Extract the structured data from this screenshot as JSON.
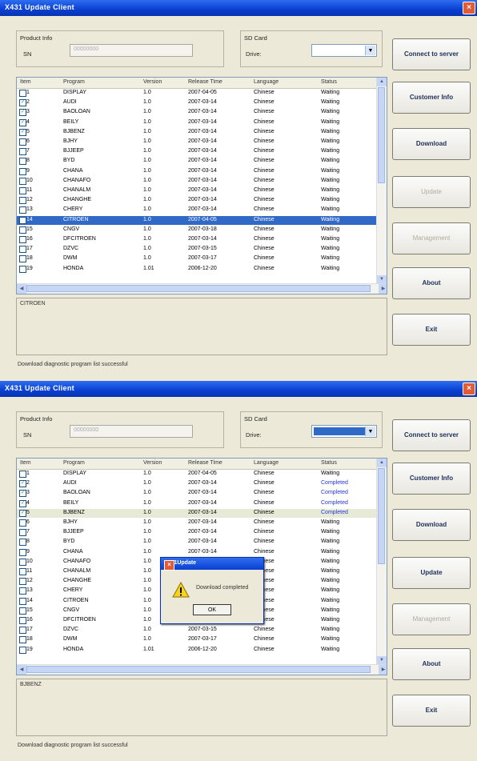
{
  "window1": {
    "title": "X431 Update Client",
    "product_info_label": "Product Info",
    "sn_label": "SN",
    "sn_value": "00000000",
    "sd_card_label": "SD Card",
    "drive_label": "Drive:",
    "columns": [
      "Item",
      "Program",
      "Version",
      "Release Time",
      "Language",
      "Status"
    ],
    "rows": [
      {
        "item": "1",
        "program": "DISPLAY",
        "version": "1.0",
        "release": "2007-04-05",
        "language": "Chinese",
        "status": "Waiting",
        "checked": false
      },
      {
        "item": "2",
        "program": "AUDI",
        "version": "1.0",
        "release": "2007-03-14",
        "language": "Chinese",
        "status": "Waiting",
        "checked": true
      },
      {
        "item": "3",
        "program": "BAOLOAN",
        "version": "1.0",
        "release": "2007-03-14",
        "language": "Chinese",
        "status": "Waiting",
        "checked": true
      },
      {
        "item": "4",
        "program": "BEILY",
        "version": "1.0",
        "release": "2007-03-14",
        "language": "Chinese",
        "status": "Waiting",
        "checked": true
      },
      {
        "item": "5",
        "program": "BJBENZ",
        "version": "1.0",
        "release": "2007-03-14",
        "language": "Chinese",
        "status": "Waiting",
        "checked": true
      },
      {
        "item": "6",
        "program": "BJHY",
        "version": "1.0",
        "release": "2007-03-14",
        "language": "Chinese",
        "status": "Waiting",
        "checked": false
      },
      {
        "item": "7",
        "program": "BJJEEP",
        "version": "1.0",
        "release": "2007-03-14",
        "language": "Chinese",
        "status": "Waiting",
        "checked": false
      },
      {
        "item": "8",
        "program": "BYD",
        "version": "1.0",
        "release": "2007-03-14",
        "language": "Chinese",
        "status": "Waiting",
        "checked": false
      },
      {
        "item": "9",
        "program": "CHANA",
        "version": "1.0",
        "release": "2007-03-14",
        "language": "Chinese",
        "status": "Waiting",
        "checked": false
      },
      {
        "item": "10",
        "program": "CHANAFO",
        "version": "1.0",
        "release": "2007-03-14",
        "language": "Chinese",
        "status": "Waiting",
        "checked": false
      },
      {
        "item": "11",
        "program": "CHANALM",
        "version": "1.0",
        "release": "2007-03-14",
        "language": "Chinese",
        "status": "Waiting",
        "checked": false
      },
      {
        "item": "12",
        "program": "CHANGHE",
        "version": "1.0",
        "release": "2007-03-14",
        "language": "Chinese",
        "status": "Waiting",
        "checked": false
      },
      {
        "item": "13",
        "program": "CHERY",
        "version": "1.0",
        "release": "2007-03-14",
        "language": "Chinese",
        "status": "Waiting",
        "checked": false
      },
      {
        "item": "14",
        "program": "CITROEN",
        "version": "1.0",
        "release": "2007-04-05",
        "language": "Chinese",
        "status": "Waiting",
        "checked": true,
        "highlight": true
      },
      {
        "item": "15",
        "program": "CNGV",
        "version": "1.0",
        "release": "2007-03-18",
        "language": "Chinese",
        "status": "Waiting",
        "checked": false
      },
      {
        "item": "16",
        "program": "DFCITROEN",
        "version": "1.0",
        "release": "2007-03-14",
        "language": "Chinese",
        "status": "Waiting",
        "checked": false
      },
      {
        "item": "17",
        "program": "DZVC",
        "version": "1.0",
        "release": "2007-03-15",
        "language": "Chinese",
        "status": "Waiting",
        "checked": false
      },
      {
        "item": "18",
        "program": "DWM",
        "version": "1.0",
        "release": "2007-03-17",
        "language": "Chinese",
        "status": "Waiting",
        "checked": false
      },
      {
        "item": "19",
        "program": "HONDA",
        "version": "1.01",
        "release": "2006-12-20",
        "language": "Chinese",
        "status": "Waiting",
        "checked": false
      }
    ],
    "info_text": "CITROEN",
    "status_text": "Download diagnostic program list successful",
    "buttons": {
      "connect": "Connect to server",
      "customer": "Customer Info",
      "download": "Download",
      "update": "Update",
      "management": "Management",
      "about": "About",
      "exit": "Exit"
    }
  },
  "window2": {
    "title": "X431 Update Client",
    "product_info_label": "Product Info",
    "sn_label": "SN",
    "sn_value": "00000000",
    "sd_card_label": "SD Card",
    "drive_label": "Drive:",
    "columns": [
      "Item",
      "Program",
      "Version",
      "Release Time",
      "Language",
      "Status"
    ],
    "rows": [
      {
        "item": "1",
        "program": "DISPLAY",
        "version": "1.0",
        "release": "2007-04-05",
        "language": "Chinese",
        "status": "Waiting",
        "checked": false
      },
      {
        "item": "2",
        "program": "AUDI",
        "version": "1.0",
        "release": "2007-03-14",
        "language": "Chinese",
        "status": "Completed",
        "checked": true
      },
      {
        "item": "3",
        "program": "BAOLOAN",
        "version": "1.0",
        "release": "2007-03-14",
        "language": "Chinese",
        "status": "Completed",
        "checked": true
      },
      {
        "item": "4",
        "program": "BEILY",
        "version": "1.0",
        "release": "2007-03-14",
        "language": "Chinese",
        "status": "Completed",
        "checked": true
      },
      {
        "item": "5",
        "program": "BJBENZ",
        "version": "1.0",
        "release": "2007-03-14",
        "language": "Chinese",
        "status": "Completed",
        "checked": true,
        "shaded": true
      },
      {
        "item": "6",
        "program": "BJHY",
        "version": "1.0",
        "release": "2007-03-14",
        "language": "Chinese",
        "status": "Waiting",
        "checked": false
      },
      {
        "item": "7",
        "program": "BJJEEP",
        "version": "1.0",
        "release": "2007-03-14",
        "language": "Chinese",
        "status": "Waiting",
        "checked": false
      },
      {
        "item": "8",
        "program": "BYD",
        "version": "1.0",
        "release": "2007-03-14",
        "language": "Chinese",
        "status": "Waiting",
        "checked": false
      },
      {
        "item": "9",
        "program": "CHANA",
        "version": "1.0",
        "release": "2007-03-14",
        "language": "Chinese",
        "status": "Waiting",
        "checked": false
      },
      {
        "item": "10",
        "program": "CHANAFO",
        "version": "1.0",
        "release": "2007-03-14",
        "language": "Chinese",
        "status": "Waiting",
        "checked": false
      },
      {
        "item": "11",
        "program": "CHANALM",
        "version": "1.0",
        "release": "2007-03-14",
        "language": "Chinese",
        "status": "Waiting",
        "checked": false
      },
      {
        "item": "12",
        "program": "CHANGHE",
        "version": "1.0",
        "release": "2007-03-14",
        "language": "Chinese",
        "status": "Waiting",
        "checked": false
      },
      {
        "item": "13",
        "program": "CHERY",
        "version": "1.0",
        "release": "2007-03-14",
        "language": "Chinese",
        "status": "Waiting",
        "checked": false
      },
      {
        "item": "14",
        "program": "CITROEN",
        "version": "1.0",
        "release": "2007-04-05",
        "language": "Chinese",
        "status": "Waiting",
        "checked": false
      },
      {
        "item": "15",
        "program": "CNGV",
        "version": "1.0",
        "release": "2007-03-18",
        "language": "Chinese",
        "status": "Waiting",
        "checked": false
      },
      {
        "item": "16",
        "program": "DFCITROEN",
        "version": "1.0",
        "release": "2007-03-14",
        "language": "Chinese",
        "status": "Waiting",
        "checked": false
      },
      {
        "item": "17",
        "program": "DZVC",
        "version": "1.0",
        "release": "2007-03-15",
        "language": "Chinese",
        "status": "Waiting",
        "checked": false
      },
      {
        "item": "18",
        "program": "DWM",
        "version": "1.0",
        "release": "2007-03-17",
        "language": "Chinese",
        "status": "Waiting",
        "checked": false
      },
      {
        "item": "19",
        "program": "HONDA",
        "version": "1.01",
        "release": "2006-12-20",
        "language": "Chinese",
        "status": "Waiting",
        "checked": false
      }
    ],
    "info_text": "BJBENZ",
    "status_text": "Download diagnostic program list successful",
    "dialog": {
      "title": "X431Update",
      "message": "Download completed",
      "ok_label": "OK"
    },
    "buttons": {
      "connect": "Connect to server",
      "customer": "Customer Info",
      "download": "Download",
      "update": "Update",
      "management": "Management",
      "about": "About",
      "exit": "Exit"
    }
  },
  "icons": {
    "close": "close-icon",
    "warning": "warning-icon",
    "scroll_up": "scroll-up-icon",
    "scroll_down": "scroll-down-icon"
  },
  "colors": {
    "titlebar": "#0a3fd0",
    "selection": "#3169c6",
    "completed_text": "#2334d6",
    "window_bg": "#ece9d8"
  }
}
